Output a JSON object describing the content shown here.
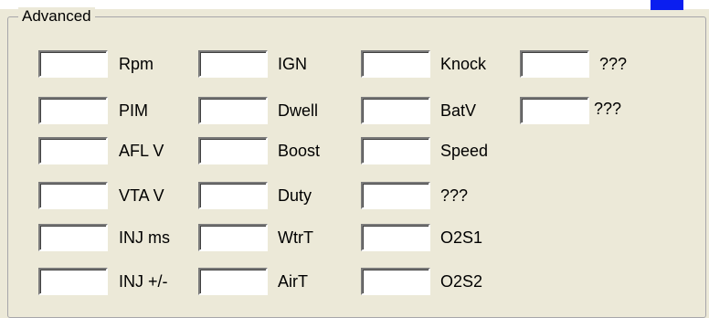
{
  "group": {
    "title": "Advanced"
  },
  "columns": [
    {
      "rows": [
        {
          "label": "Rpm",
          "value": ""
        },
        {
          "label": "PIM",
          "value": ""
        },
        {
          "label": "AFL V",
          "value": ""
        },
        {
          "label": "VTA V",
          "value": ""
        },
        {
          "label": "INJ ms",
          "value": ""
        },
        {
          "label": "INJ +/-",
          "value": ""
        }
      ]
    },
    {
      "rows": [
        {
          "label": "IGN",
          "value": ""
        },
        {
          "label": "Dwell",
          "value": ""
        },
        {
          "label": "Boost",
          "value": ""
        },
        {
          "label": "Duty",
          "value": ""
        },
        {
          "label": "WtrT",
          "value": ""
        },
        {
          "label": "AirT",
          "value": ""
        }
      ]
    },
    {
      "rows": [
        {
          "label": "Knock",
          "value": ""
        },
        {
          "label": "BatV",
          "value": ""
        },
        {
          "label": "Speed",
          "value": ""
        },
        {
          "label": "???",
          "value": ""
        },
        {
          "label": "O2S1",
          "value": ""
        },
        {
          "label": "O2S2",
          "value": ""
        }
      ]
    },
    {
      "rows": [
        {
          "label": "???",
          "value": ""
        },
        {
          "label": "???",
          "value": ""
        }
      ]
    }
  ]
}
